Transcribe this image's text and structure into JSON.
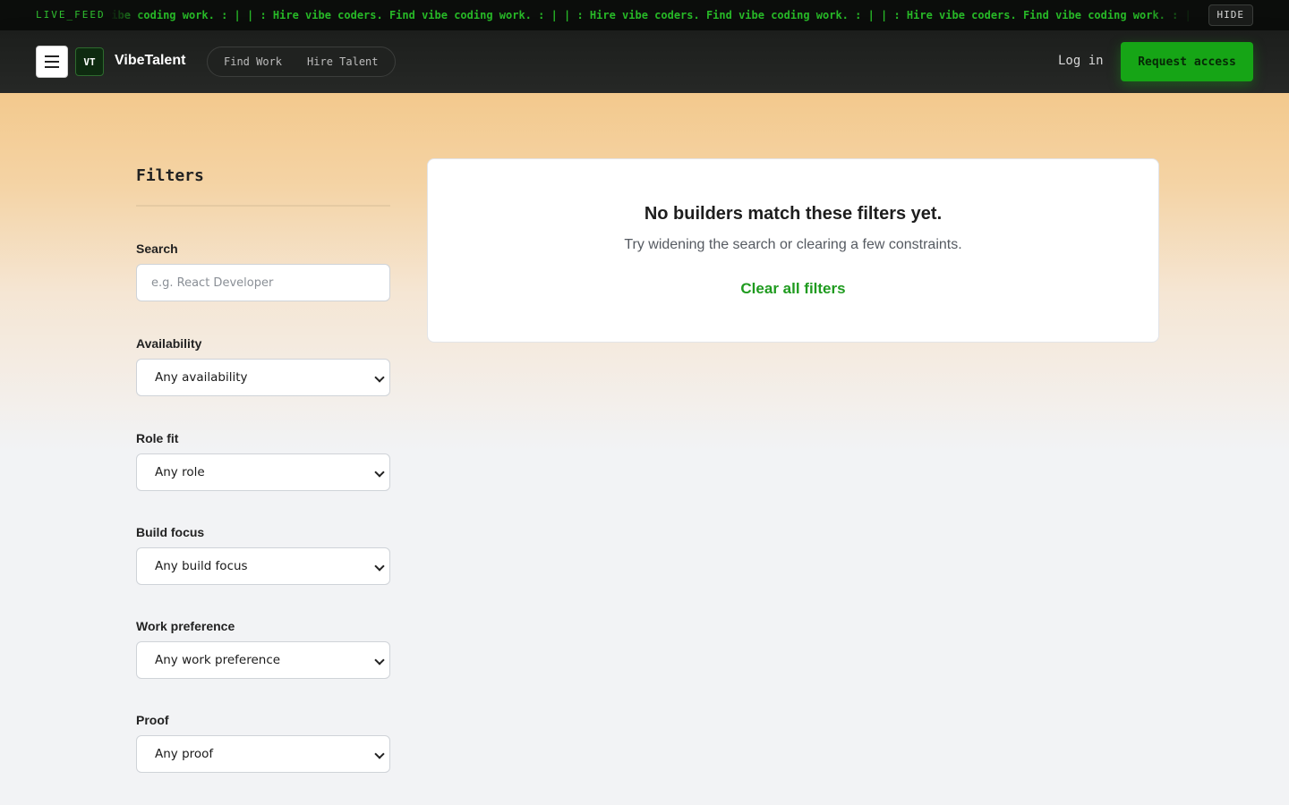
{
  "ticker": {
    "label": "LIVE_FEED",
    "text": "| : Hire vibe coders. Find vibe coding work. : |    | : Hire vibe coders. Find vibe coding work. : |    | : Hire vibe coders. Find vibe coding work. : |    | : Hire vibe coders. Find vibe coding work. : |",
    "hide_label": "HIDE"
  },
  "nav": {
    "logo_text": "VT",
    "brand": "VibeTalent",
    "links": [
      "Find Work",
      "Hire Talent"
    ],
    "login_label": "Log in",
    "request_label": "Request access"
  },
  "filters": {
    "title": "Filters",
    "search": {
      "label": "Search",
      "placeholder": "e.g. React Developer",
      "value": ""
    },
    "availability": {
      "label": "Availability",
      "value": "Any availability"
    },
    "role_fit": {
      "label": "Role fit",
      "value": "Any role"
    },
    "build_focus": {
      "label": "Build focus",
      "value": "Any build focus"
    },
    "work_preference": {
      "label": "Work preference",
      "value": "Any work preference"
    },
    "proof": {
      "label": "Proof",
      "value": "Any proof"
    }
  },
  "empty_state": {
    "title": "No builders match these filters yet.",
    "subtitle": "Try widening the search or clearing a few constraints.",
    "clear_label": "Clear all filters"
  },
  "colors": {
    "accent": "#16a516",
    "link": "#1f9b1f",
    "ticker_text": "#27b827",
    "navbar_bg": "#1c1e1c",
    "glow": "#f3c98d"
  }
}
